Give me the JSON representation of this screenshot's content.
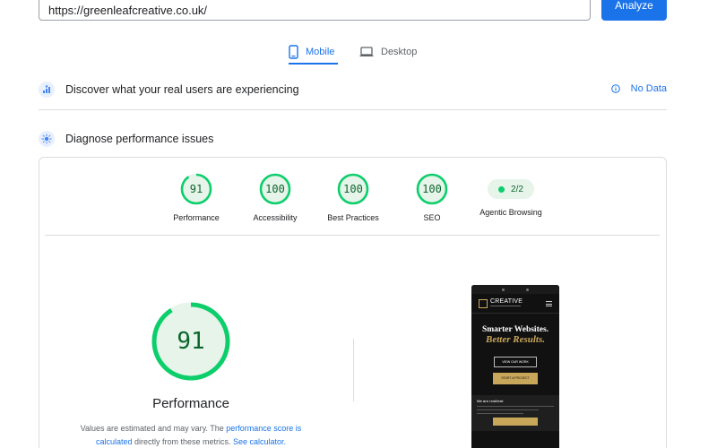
{
  "search": {
    "url": "https://greenleafcreative.co.uk/",
    "analyze_label": "Analyze"
  },
  "tabs": [
    {
      "label": "Mobile",
      "icon": "phone-icon",
      "active": true
    },
    {
      "label": "Desktop",
      "icon": "laptop-icon",
      "active": false
    }
  ],
  "real_users": {
    "title": "Discover what your real users are experiencing",
    "no_data_label": "No Data"
  },
  "diagnose": {
    "title": "Diagnose performance issues"
  },
  "scores": [
    {
      "label": "Performance",
      "value": "91"
    },
    {
      "label": "Accessibility",
      "value": "100"
    },
    {
      "label": "Best Practices",
      "value": "100"
    },
    {
      "label": "SEO",
      "value": "100"
    }
  ],
  "agentic": {
    "label": "Agentic Browsing",
    "value": "2/2"
  },
  "main_score": {
    "value": "91",
    "fraction": 0.91,
    "label": "Performance",
    "note_start": "Values are estimated and may vary. The ",
    "note_link1": "performance score is calculated",
    "note_mid": " directly from these metrics. ",
    "note_link2": "See calculator."
  },
  "preview": {
    "brand": "CREATIVE",
    "headline": "Smarter Websites.",
    "headline_accent": "Better Results.",
    "btn_primary": "VIEW OUR WORK",
    "btn_secondary": "START A PROJECT",
    "section_title": "We are resilient"
  },
  "colors": {
    "accent": "#1a73e8",
    "pass": "#0cce6b",
    "pass_text": "#0d652d",
    "pass_bg": "#e6f4ea",
    "gold": "#c9a75a"
  }
}
